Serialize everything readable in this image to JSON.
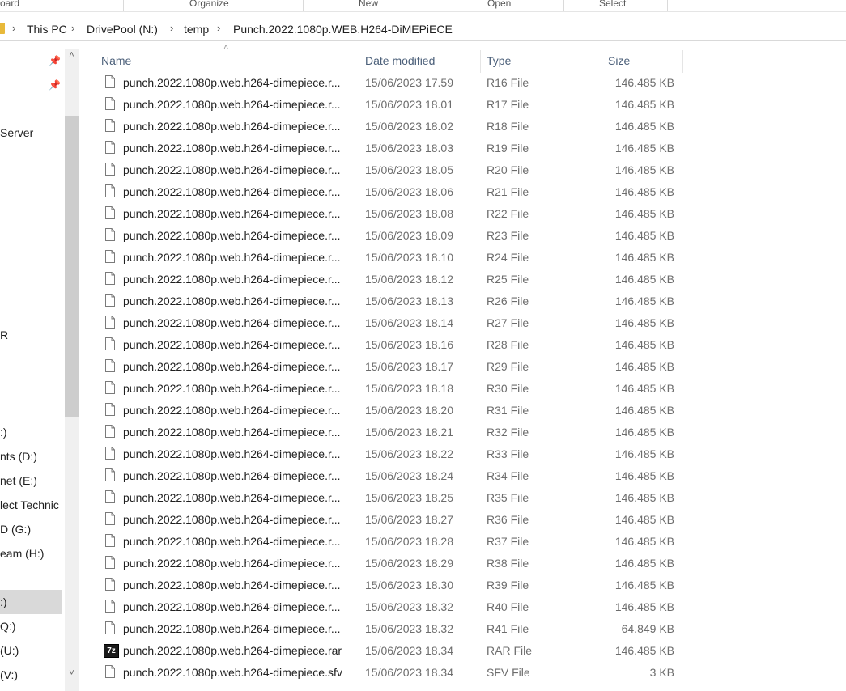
{
  "ribbon": {
    "groups": [
      {
        "key": "clipboard",
        "label": "oard"
      },
      {
        "key": "organize",
        "label": "Organize"
      },
      {
        "key": "new",
        "label": "New"
      },
      {
        "key": "open",
        "label": "Open"
      },
      {
        "key": "select",
        "label": "Select"
      }
    ]
  },
  "address": {
    "crumbs": [
      "This PC",
      "DrivePool (N:)",
      "temp",
      "Punch.2022.1080p.WEB.H264-DiMEPiECE"
    ]
  },
  "nav": {
    "items": [
      "Server",
      "R",
      ":)",
      "nts (D:)",
      "net (E:)",
      "lect Technic",
      "D (G:)",
      "eam (H:)",
      ":)",
      "Q:)",
      "(U:)",
      "(V:)"
    ],
    "selected_index": 8,
    "icons": [
      "pin-icon",
      "pin-icon",
      "chevron-up-icon",
      "chevron-down-icon"
    ]
  },
  "table": {
    "columns": {
      "name": "Name",
      "date": "Date modified",
      "type": "Type",
      "size": "Size"
    },
    "rows": [
      {
        "name": "punch.2022.1080p.web.h264-dimepiece.r...",
        "date": "15/06/2023 17.59",
        "type": "R16 File",
        "size": "146.485 KB",
        "icon": "file-icon"
      },
      {
        "name": "punch.2022.1080p.web.h264-dimepiece.r...",
        "date": "15/06/2023 18.01",
        "type": "R17 File",
        "size": "146.485 KB",
        "icon": "file-icon"
      },
      {
        "name": "punch.2022.1080p.web.h264-dimepiece.r...",
        "date": "15/06/2023 18.02",
        "type": "R18 File",
        "size": "146.485 KB",
        "icon": "file-icon"
      },
      {
        "name": "punch.2022.1080p.web.h264-dimepiece.r...",
        "date": "15/06/2023 18.03",
        "type": "R19 File",
        "size": "146.485 KB",
        "icon": "file-icon"
      },
      {
        "name": "punch.2022.1080p.web.h264-dimepiece.r...",
        "date": "15/06/2023 18.05",
        "type": "R20 File",
        "size": "146.485 KB",
        "icon": "file-icon"
      },
      {
        "name": "punch.2022.1080p.web.h264-dimepiece.r...",
        "date": "15/06/2023 18.06",
        "type": "R21 File",
        "size": "146.485 KB",
        "icon": "file-icon"
      },
      {
        "name": "punch.2022.1080p.web.h264-dimepiece.r...",
        "date": "15/06/2023 18.08",
        "type": "R22 File",
        "size": "146.485 KB",
        "icon": "file-icon"
      },
      {
        "name": "punch.2022.1080p.web.h264-dimepiece.r...",
        "date": "15/06/2023 18.09",
        "type": "R23 File",
        "size": "146.485 KB",
        "icon": "file-icon"
      },
      {
        "name": "punch.2022.1080p.web.h264-dimepiece.r...",
        "date": "15/06/2023 18.10",
        "type": "R24 File",
        "size": "146.485 KB",
        "icon": "file-icon"
      },
      {
        "name": "punch.2022.1080p.web.h264-dimepiece.r...",
        "date": "15/06/2023 18.12",
        "type": "R25 File",
        "size": "146.485 KB",
        "icon": "file-icon"
      },
      {
        "name": "punch.2022.1080p.web.h264-dimepiece.r...",
        "date": "15/06/2023 18.13",
        "type": "R26 File",
        "size": "146.485 KB",
        "icon": "file-icon"
      },
      {
        "name": "punch.2022.1080p.web.h264-dimepiece.r...",
        "date": "15/06/2023 18.14",
        "type": "R27 File",
        "size": "146.485 KB",
        "icon": "file-icon"
      },
      {
        "name": "punch.2022.1080p.web.h264-dimepiece.r...",
        "date": "15/06/2023 18.16",
        "type": "R28 File",
        "size": "146.485 KB",
        "icon": "file-icon"
      },
      {
        "name": "punch.2022.1080p.web.h264-dimepiece.r...",
        "date": "15/06/2023 18.17",
        "type": "R29 File",
        "size": "146.485 KB",
        "icon": "file-icon"
      },
      {
        "name": "punch.2022.1080p.web.h264-dimepiece.r...",
        "date": "15/06/2023 18.18",
        "type": "R30 File",
        "size": "146.485 KB",
        "icon": "file-icon"
      },
      {
        "name": "punch.2022.1080p.web.h264-dimepiece.r...",
        "date": "15/06/2023 18.20",
        "type": "R31 File",
        "size": "146.485 KB",
        "icon": "file-icon"
      },
      {
        "name": "punch.2022.1080p.web.h264-dimepiece.r...",
        "date": "15/06/2023 18.21",
        "type": "R32 File",
        "size": "146.485 KB",
        "icon": "file-icon"
      },
      {
        "name": "punch.2022.1080p.web.h264-dimepiece.r...",
        "date": "15/06/2023 18.22",
        "type": "R33 File",
        "size": "146.485 KB",
        "icon": "file-icon"
      },
      {
        "name": "punch.2022.1080p.web.h264-dimepiece.r...",
        "date": "15/06/2023 18.24",
        "type": "R34 File",
        "size": "146.485 KB",
        "icon": "file-icon"
      },
      {
        "name": "punch.2022.1080p.web.h264-dimepiece.r...",
        "date": "15/06/2023 18.25",
        "type": "R35 File",
        "size": "146.485 KB",
        "icon": "file-icon"
      },
      {
        "name": "punch.2022.1080p.web.h264-dimepiece.r...",
        "date": "15/06/2023 18.27",
        "type": "R36 File",
        "size": "146.485 KB",
        "icon": "file-icon"
      },
      {
        "name": "punch.2022.1080p.web.h264-dimepiece.r...",
        "date": "15/06/2023 18.28",
        "type": "R37 File",
        "size": "146.485 KB",
        "icon": "file-icon"
      },
      {
        "name": "punch.2022.1080p.web.h264-dimepiece.r...",
        "date": "15/06/2023 18.29",
        "type": "R38 File",
        "size": "146.485 KB",
        "icon": "file-icon"
      },
      {
        "name": "punch.2022.1080p.web.h264-dimepiece.r...",
        "date": "15/06/2023 18.30",
        "type": "R39 File",
        "size": "146.485 KB",
        "icon": "file-icon"
      },
      {
        "name": "punch.2022.1080p.web.h264-dimepiece.r...",
        "date": "15/06/2023 18.32",
        "type": "R40 File",
        "size": "146.485 KB",
        "icon": "file-icon"
      },
      {
        "name": "punch.2022.1080p.web.h264-dimepiece.r...",
        "date": "15/06/2023 18.32",
        "type": "R41 File",
        "size": "64.849 KB",
        "icon": "file-icon"
      },
      {
        "name": "punch.2022.1080p.web.h264-dimepiece.rar",
        "date": "15/06/2023 18.34",
        "type": "RAR File",
        "size": "146.485 KB",
        "icon": "7z-archive-icon",
        "icon_text": "7z"
      },
      {
        "name": "punch.2022.1080p.web.h264-dimepiece.sfv",
        "date": "15/06/2023 18.34",
        "type": "SFV File",
        "size": "3 KB",
        "icon": "file-icon"
      }
    ]
  }
}
